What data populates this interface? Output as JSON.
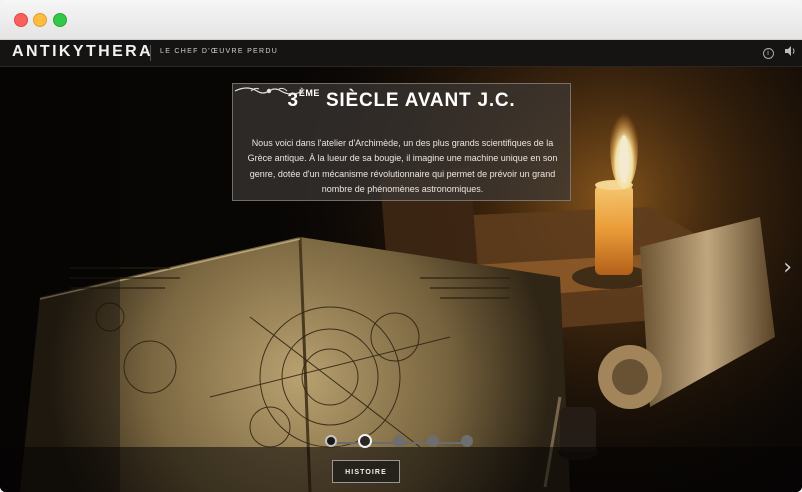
{
  "window": {
    "controls": [
      "close",
      "minimize",
      "maximize"
    ]
  },
  "header": {
    "brand": "ANTIKYTHERA",
    "subtitle": "LE CHEF D'ŒUVRE PERDU",
    "icons": {
      "info": "info-icon",
      "sound": "speaker-icon"
    }
  },
  "caption": {
    "title_prefix": "3",
    "title_sup": "ÈME",
    "title_rest": " SIÈCLE AVANT J.C.",
    "ornament": "ornament-icon",
    "text": "Nous voici dans l'atelier d'Archimède, un des plus grands scientifiques de la Grèce antique. À la lueur de sa bougie, il imagine une machine unique en son genre, dotée d'un mécanisme révolutionnaire qui permet de prévoir un grand nombre de phénomènes astronomiques."
  },
  "navigation": {
    "next_icon": "chevron-right-icon"
  },
  "timeline": {
    "total_steps": 5,
    "current_step": 2,
    "steps": [
      "done",
      "current",
      "todo",
      "todo",
      "todo"
    ]
  },
  "history_button": {
    "label": "HISTOIRE"
  }
}
